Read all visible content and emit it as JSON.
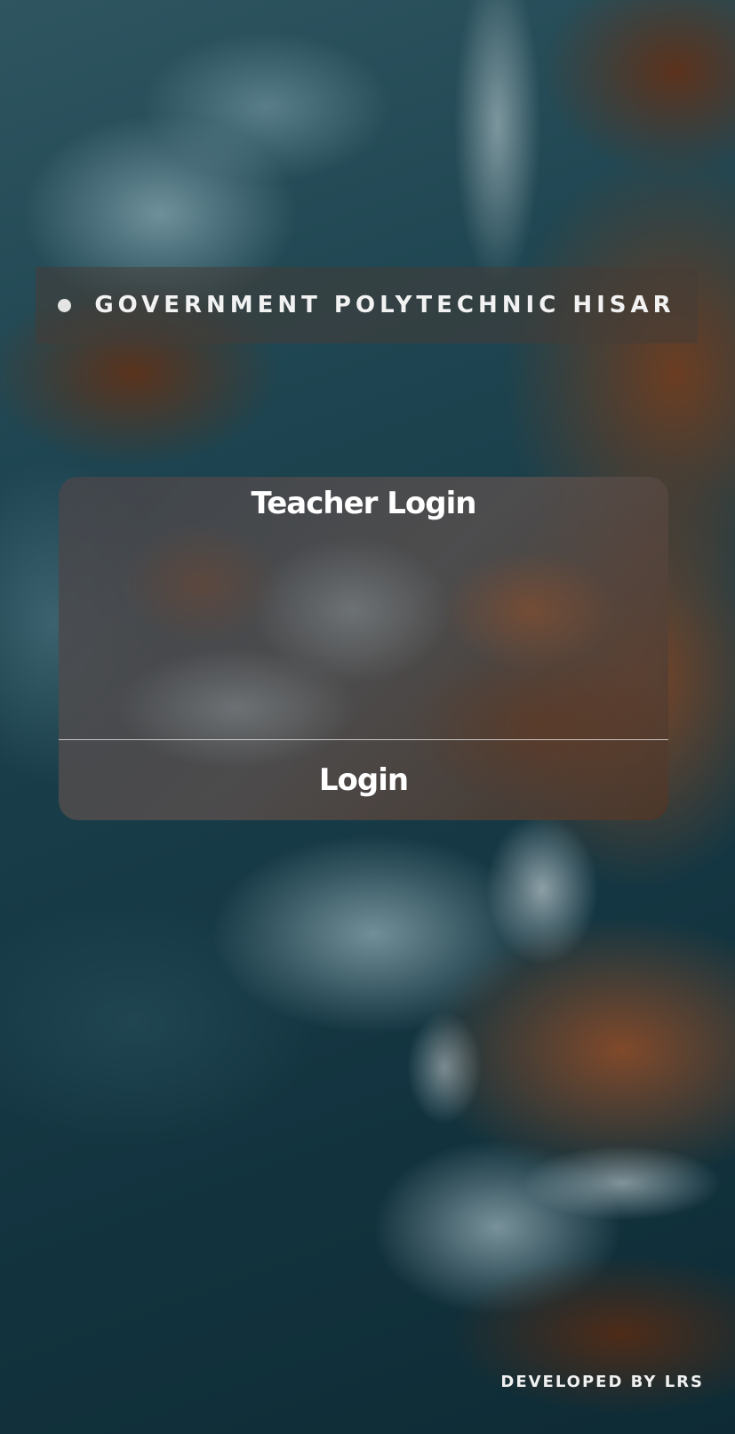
{
  "header": {
    "title": "GOVERNMENT POLYTECHNIC HISAR"
  },
  "login_card": {
    "title": "Teacher Login",
    "button_label": "Login"
  },
  "footer": {
    "credit": "DEVELOPED BY LRS"
  },
  "colors": {
    "sea": "#163641",
    "cliff": "#7a4526",
    "text": "#ffffff"
  },
  "icons": {
    "header_bullet": "dot-icon"
  }
}
